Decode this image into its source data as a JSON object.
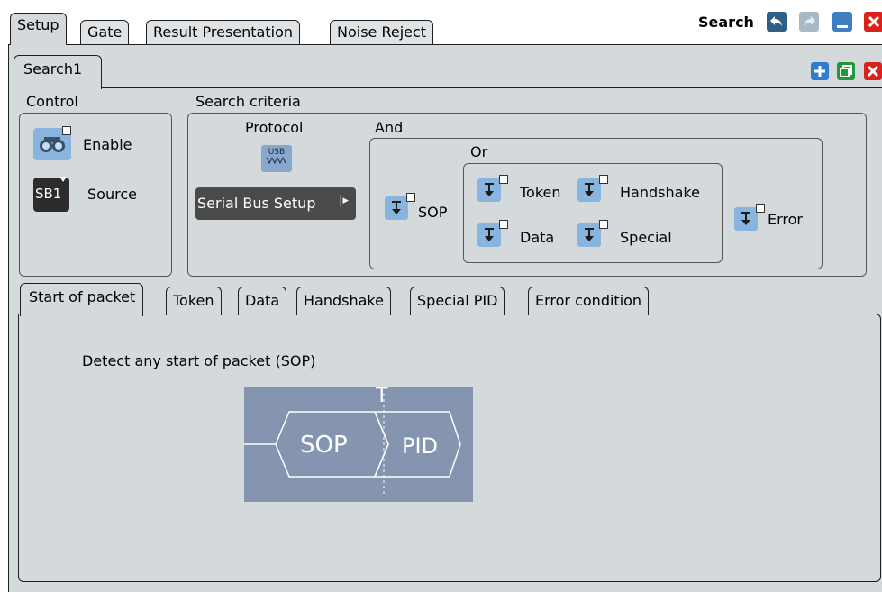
{
  "top_tabs": [
    {
      "label": "Setup"
    },
    {
      "label": "Gate"
    },
    {
      "label": "Result Presentation"
    },
    {
      "label": "Noise Reject"
    }
  ],
  "window": {
    "title": "Search"
  },
  "sub_tabs": [
    {
      "label": "Search1"
    }
  ],
  "control": {
    "heading": "Control",
    "enable_label": "Enable",
    "source_label": "Source",
    "source_icon_text": "SB1"
  },
  "criteria": {
    "heading": "Search criteria",
    "protocol_label": "Protocol",
    "protocol_icon_text": "USB",
    "serial_bus_setup": "Serial Bus Setup",
    "and_label": "And",
    "or_label": "Or",
    "sop": "SOP",
    "token": "Token",
    "handshake": "Handshake",
    "data": "Data",
    "special": "Special",
    "error": "Error"
  },
  "bottom_tabs": [
    {
      "label": "Start of packet"
    },
    {
      "label": "Token"
    },
    {
      "label": "Data"
    },
    {
      "label": "Handshake"
    },
    {
      "label": "Special PID"
    },
    {
      "label": "Error condition"
    }
  ],
  "sop_panel": {
    "description": "Detect any start of packet (SOP)",
    "diagram_left": "SOP",
    "diagram_right": "PID",
    "diagram_marker": "T"
  },
  "colors": {
    "panel_bg": "#d4d9dc",
    "toggle_icon": "#89b4dd",
    "diagram_bg": "#8595b0",
    "close_red": "#d9221b",
    "add_blue": "#2f7dd0",
    "copy_green": "#1f9a3a"
  }
}
